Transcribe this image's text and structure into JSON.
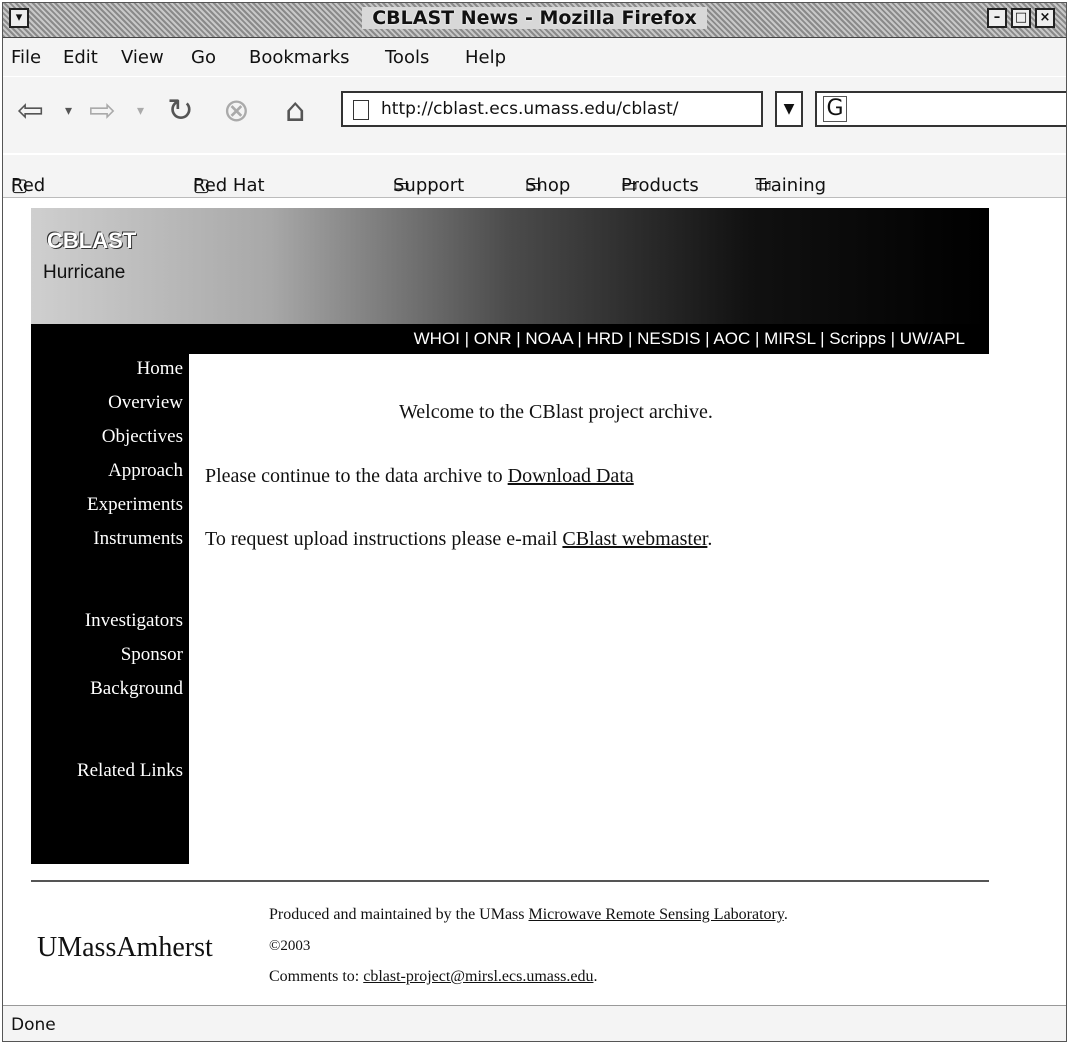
{
  "window": {
    "title": "CBLAST News - Mozilla Firefox",
    "menu_button": "▾",
    "minimize": "–",
    "maximize": "□",
    "close": "×"
  },
  "menu": {
    "items": [
      {
        "label": "File"
      },
      {
        "label": "Edit"
      },
      {
        "label": "View"
      },
      {
        "label": "Go"
      },
      {
        "label": "Bookmarks"
      },
      {
        "label": "Tools"
      },
      {
        "label": "Help"
      }
    ]
  },
  "navbar": {
    "back_icon": "⇦",
    "forward_icon": "⇨",
    "reload_icon": "↻",
    "stop_icon": "⊗",
    "home_icon": "⌂",
    "url": "http://cblast.ecs.umass.edu/cblast/",
    "search_icon": "G"
  },
  "bookmarks": {
    "items": [
      {
        "label": "Red Hat, Inc."
      },
      {
        "label": "Red Hat Network"
      },
      {
        "label": "Support"
      },
      {
        "label": "Shop"
      },
      {
        "label": "Products"
      },
      {
        "label": "Training"
      }
    ]
  },
  "page": {
    "banner": {
      "line1": "CBLAST",
      "line2": "Hurricane"
    },
    "partners": "WHOI | ONR | NOAA | HRD | NESDIS | AOC | MIRSL | Scripps | UW/APL",
    "sidebar": [
      {
        "label": "Home"
      },
      {
        "label": "Overview"
      },
      {
        "label": "Objectives"
      },
      {
        "label": "Approach"
      },
      {
        "label": "Experiments"
      },
      {
        "label": "Instruments"
      },
      {
        "label": "Investigators"
      },
      {
        "label": "Sponsor"
      },
      {
        "label": "Background"
      },
      {
        "label": "Related Links"
      }
    ],
    "welcome": "Welcome to the CBlast project archive.",
    "line1_text": "Please continue to the data archive to ",
    "line1_link": "Download Data",
    "line2_text": "To request upload instructions please e-mail ",
    "line2_link": "CBlast webmaster",
    "line2_end": ".",
    "footer": {
      "logo": "UMassAmherst",
      "produced_text": "Produced and maintained by the UMass ",
      "produced_link": "Microwave Remote Sensing Laboratory",
      "produced_end": ".",
      "copyright": "©2003",
      "comments_text": "Comments to: ",
      "comments_link": "cblast-project@mirsl.ecs.umass.edu",
      "comments_end": "."
    }
  },
  "status": {
    "text": "Done"
  }
}
